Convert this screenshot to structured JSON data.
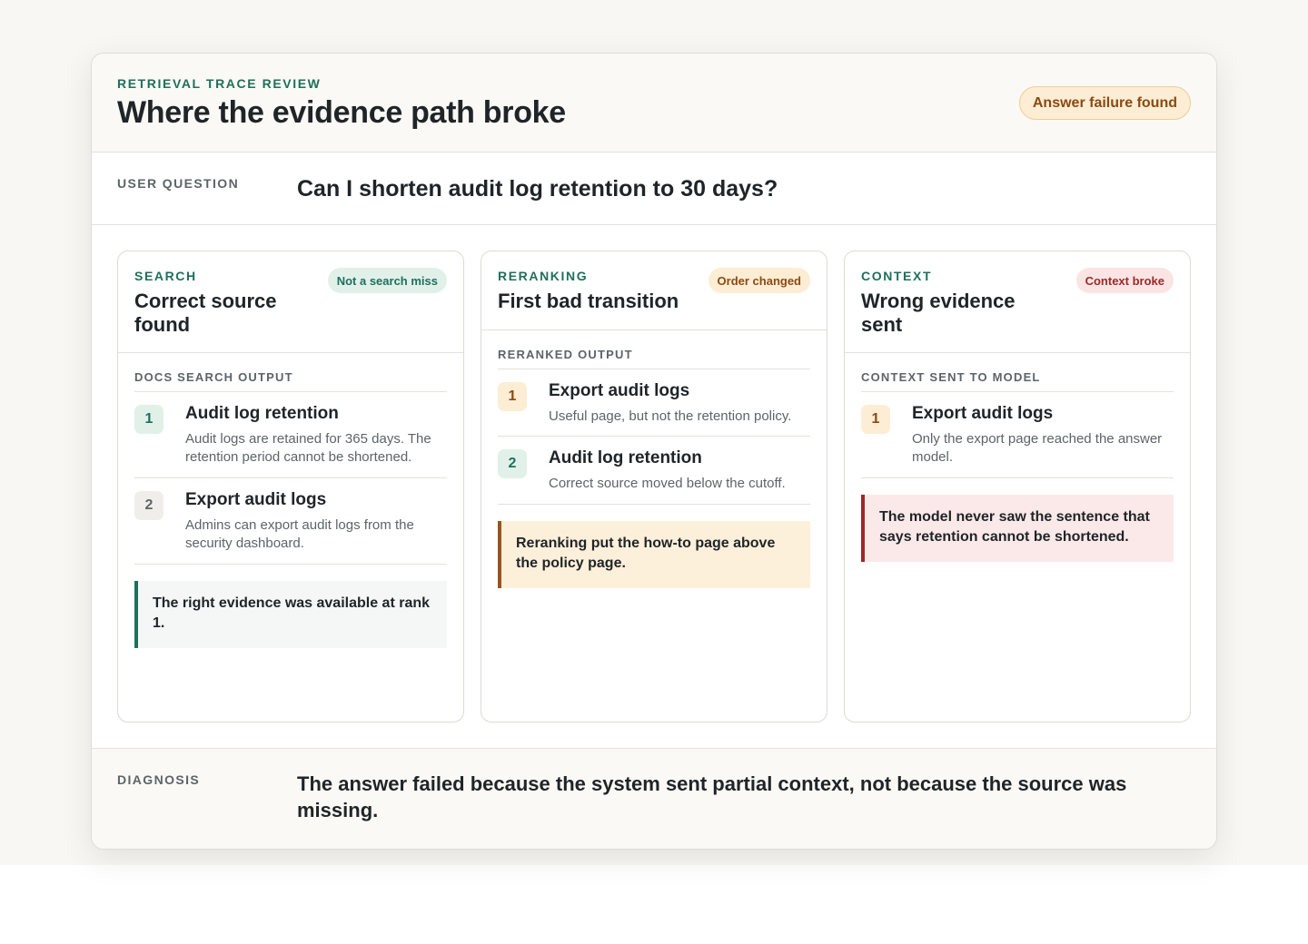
{
  "header": {
    "eyebrow": "RETRIEVAL TRACE REVIEW",
    "title": "Where the evidence path broke",
    "status": "Answer failure found"
  },
  "question": {
    "label": "USER QUESTION",
    "text": "Can I shorten audit log retention to 30 days?"
  },
  "stages": {
    "search": {
      "eyebrow": "SEARCH",
      "title": "Correct source found",
      "badge": "Not a search miss",
      "section_label": "DOCS SEARCH OUTPUT",
      "items": [
        {
          "rank": "1",
          "title": "Audit log retention",
          "desc": "Audit logs are retained for 365 days. The retention period cannot be shortened."
        },
        {
          "rank": "2",
          "title": "Export audit logs",
          "desc": "Admins can export audit logs from the security dashboard."
        }
      ],
      "callout": "The right evidence was available at rank 1."
    },
    "reranking": {
      "eyebrow": "RERANKING",
      "title": "First bad transition",
      "badge": "Order changed",
      "section_label": "RERANKED OUTPUT",
      "items": [
        {
          "rank": "1",
          "title": "Export audit logs",
          "desc": "Useful page, but not the retention policy."
        },
        {
          "rank": "2",
          "title": "Audit log retention",
          "desc": "Correct source moved below the cutoff."
        }
      ],
      "callout": "Reranking put the how-to page above the policy page."
    },
    "context": {
      "eyebrow": "CONTEXT",
      "title": "Wrong evidence sent",
      "badge": "Context broke",
      "section_label": "CONTEXT SENT TO MODEL",
      "items": [
        {
          "rank": "1",
          "title": "Export audit logs",
          "desc": "Only the export page reached the answer model."
        }
      ],
      "callout": "The model never saw the sentence that says retention cannot be shortened."
    }
  },
  "diagnosis": {
    "label": "DIAGNOSIS",
    "text": "The answer failed because the system sent partial context, not because the source was missing."
  },
  "colors": {
    "accent_green": "#1f6f5c",
    "accent_amber": "#8a4a14",
    "accent_red": "#9a2a2a"
  }
}
